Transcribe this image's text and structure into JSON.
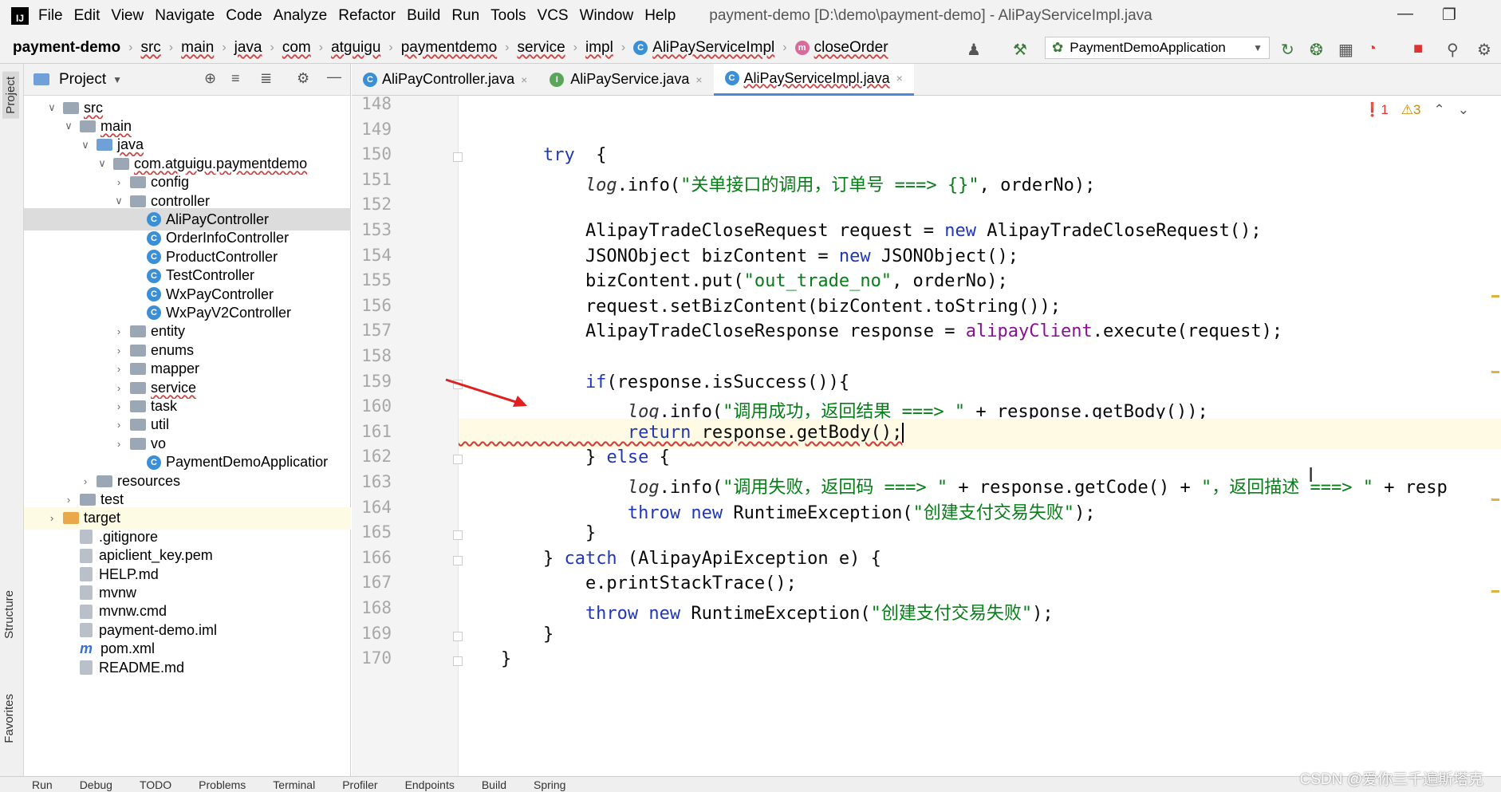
{
  "window": {
    "title": "payment-demo [D:\\demo\\payment-demo] - AliPayServiceImpl.java",
    "menu": [
      {
        "label": "File"
      },
      {
        "label": "Edit"
      },
      {
        "label": "View"
      },
      {
        "label": "Navigate"
      },
      {
        "label": "Code"
      },
      {
        "label": "Analyze"
      },
      {
        "label": "Refactor"
      },
      {
        "label": "Build"
      },
      {
        "label": "Run"
      },
      {
        "label": "Tools"
      },
      {
        "label": "VCS"
      },
      {
        "label": "Window"
      },
      {
        "label": "Help"
      }
    ]
  },
  "breadcrumb": {
    "items": [
      "payment-demo",
      "src",
      "main",
      "java",
      "com",
      "atguigu",
      "paymentdemo",
      "service",
      "impl",
      "AliPayServiceImpl",
      "closeOrder"
    ]
  },
  "toolbar": {
    "run_config": "PaymentDemoApplication"
  },
  "left_strip": {
    "project": "Project",
    "structure": "Structure",
    "favorites": "Favorites"
  },
  "project_panel": {
    "title": "Project",
    "tree": [
      {
        "label": "src",
        "indent": 1,
        "arrow": "v",
        "icon": "folder"
      },
      {
        "label": "main",
        "indent": 2,
        "arrow": "v",
        "icon": "folder"
      },
      {
        "label": "java",
        "indent": 3,
        "arrow": "v",
        "icon": "folder-blue"
      },
      {
        "label": "com.atguigu.paymentdemo",
        "indent": 4,
        "arrow": "v",
        "icon": "folder"
      },
      {
        "label": "config",
        "indent": 5,
        "arrow": ">",
        "icon": "folder"
      },
      {
        "label": "controller",
        "indent": 5,
        "arrow": "v",
        "icon": "folder"
      },
      {
        "label": "AliPayController",
        "indent": 6,
        "arrow": "",
        "icon": "class",
        "selected": true
      },
      {
        "label": "OrderInfoController",
        "indent": 6,
        "arrow": "",
        "icon": "class"
      },
      {
        "label": "ProductController",
        "indent": 6,
        "arrow": "",
        "icon": "class"
      },
      {
        "label": "TestController",
        "indent": 6,
        "arrow": "",
        "icon": "class"
      },
      {
        "label": "WxPayController",
        "indent": 6,
        "arrow": "",
        "icon": "class"
      },
      {
        "label": "WxPayV2Controller",
        "indent": 6,
        "arrow": "",
        "icon": "class"
      },
      {
        "label": "entity",
        "indent": 5,
        "arrow": ">",
        "icon": "folder"
      },
      {
        "label": "enums",
        "indent": 5,
        "arrow": ">",
        "icon": "folder"
      },
      {
        "label": "mapper",
        "indent": 5,
        "arrow": ">",
        "icon": "folder"
      },
      {
        "label": "service",
        "indent": 5,
        "arrow": ">",
        "icon": "folder"
      },
      {
        "label": "task",
        "indent": 5,
        "arrow": ">",
        "icon": "folder"
      },
      {
        "label": "util",
        "indent": 5,
        "arrow": ">",
        "icon": "folder"
      },
      {
        "label": "vo",
        "indent": 5,
        "arrow": ">",
        "icon": "folder"
      },
      {
        "label": "PaymentDemoApplicatior",
        "indent": 6,
        "arrow": "",
        "icon": "class"
      },
      {
        "label": "resources",
        "indent": 3,
        "arrow": ">",
        "icon": "folder"
      },
      {
        "label": "test",
        "indent": 2,
        "arrow": ">",
        "icon": "folder"
      },
      {
        "label": "target",
        "indent": 1,
        "arrow": ">",
        "icon": "folder-orange",
        "highlight": true
      },
      {
        "label": ".gitignore",
        "indent": 2,
        "arrow": "",
        "icon": "file"
      },
      {
        "label": "apiclient_key.pem",
        "indent": 2,
        "arrow": "",
        "icon": "file"
      },
      {
        "label": "HELP.md",
        "indent": 2,
        "arrow": "",
        "icon": "file"
      },
      {
        "label": "mvnw",
        "indent": 2,
        "arrow": "",
        "icon": "file"
      },
      {
        "label": "mvnw.cmd",
        "indent": 2,
        "arrow": "",
        "icon": "file"
      },
      {
        "label": "payment-demo.iml",
        "indent": 2,
        "arrow": "",
        "icon": "file"
      },
      {
        "label": "pom.xml",
        "indent": 2,
        "arrow": "",
        "icon": "maven"
      },
      {
        "label": "README.md",
        "indent": 2,
        "arrow": "",
        "icon": "file"
      }
    ]
  },
  "tabs": [
    {
      "label": "AliPayController.java",
      "icon": "C",
      "active": false
    },
    {
      "label": "AliPayService.java",
      "icon": "I",
      "active": false
    },
    {
      "label": "AliPayServiceImpl.java",
      "icon": "C",
      "active": true
    }
  ],
  "inspections": {
    "errors": "1",
    "warnings": "3"
  },
  "code": {
    "line_numbers": [
      "148",
      "149",
      "150",
      "151",
      "152",
      "153",
      "154",
      "155",
      "156",
      "157",
      "158",
      "159",
      "160",
      "161",
      "162",
      "163",
      "164",
      "165",
      "166",
      "167",
      "168",
      "169",
      "170"
    ],
    "lines": [
      [],
      [],
      [
        [
          "kw",
          "        try"
        ],
        [
          "",
          "  {"
        ]
      ],
      [
        [
          "it",
          "            log"
        ],
        [
          "",
          ".info("
        ],
        [
          "str",
          "\"关单接口的调用，订单号 ===> {}\""
        ],
        [
          "",
          ", orderNo);"
        ]
      ],
      [],
      [
        [
          "",
          "            AlipayTradeCloseRequest request = "
        ],
        [
          "kw",
          "new"
        ],
        [
          "",
          " AlipayTradeCloseRequest();"
        ]
      ],
      [
        [
          "",
          "            JSONObject bizContent = "
        ],
        [
          "kw",
          "new"
        ],
        [
          "",
          " JSONObject();"
        ]
      ],
      [
        [
          "",
          "            bizContent.put("
        ],
        [
          "str",
          "\"out_trade_no\""
        ],
        [
          "",
          ", orderNo);"
        ]
      ],
      [
        [
          "",
          "            request.setBizContent(bizContent.toString());"
        ]
      ],
      [
        [
          "",
          "            AlipayTradeCloseResponse response = "
        ],
        [
          "fld",
          "alipayClient"
        ],
        [
          "",
          ".execute(request);"
        ]
      ],
      [],
      [
        [
          "kw",
          "            if"
        ],
        [
          "",
          "(response.isSuccess()){"
        ]
      ],
      [
        [
          "it",
          "                log"
        ],
        [
          "",
          ".info("
        ],
        [
          "str",
          "\"调用成功，返回结果 ===> \""
        ],
        [
          "",
          " + response.getBody());"
        ]
      ],
      [
        [
          "kw err",
          "                return"
        ],
        [
          "err",
          " response.getBody();"
        ]
      ],
      [
        [
          "",
          "            } "
        ],
        [
          "kw",
          "else"
        ],
        [
          "",
          " {"
        ]
      ],
      [
        [
          "it",
          "                log"
        ],
        [
          "",
          ".info("
        ],
        [
          "str",
          "\"调用失败，返回码 ===> \""
        ],
        [
          "",
          " + response.getCode() + "
        ],
        [
          "str",
          "\"，返回描述 ===> \""
        ],
        [
          "",
          " + resp"
        ]
      ],
      [
        [
          "kw",
          "                throw new"
        ],
        [
          "",
          " RuntimeException("
        ],
        [
          "str",
          "\"创建支付交易失败\""
        ],
        [
          "",
          ");"
        ]
      ],
      [
        [
          "",
          "            }"
        ]
      ],
      [
        [
          "",
          "        } "
        ],
        [
          "kw",
          "catch"
        ],
        [
          "",
          " (AlipayApiException e) {"
        ]
      ],
      [
        [
          "",
          "            e.printStackTrace();"
        ]
      ],
      [
        [
          "kw",
          "            throw new"
        ],
        [
          "",
          " RuntimeException("
        ],
        [
          "str",
          "\"创建支付交易失败\""
        ],
        [
          "",
          ");"
        ]
      ],
      [
        [
          "",
          "        }"
        ]
      ],
      [
        [
          "",
          "    }"
        ]
      ]
    ]
  },
  "bottom_tools": [
    "Run",
    "Debug",
    "TODO",
    "Problems",
    "Terminal",
    "Profiler",
    "Endpoints",
    "Build",
    "Spring"
  ],
  "watermark": "CSDN @爱你三千遍斯塔克",
  "colors": {
    "keyword": "#1f37b8",
    "string": "#067d17",
    "field": "#871094",
    "annotation_arrow": "#e02020",
    "active_tab": "#4a88d8"
  }
}
